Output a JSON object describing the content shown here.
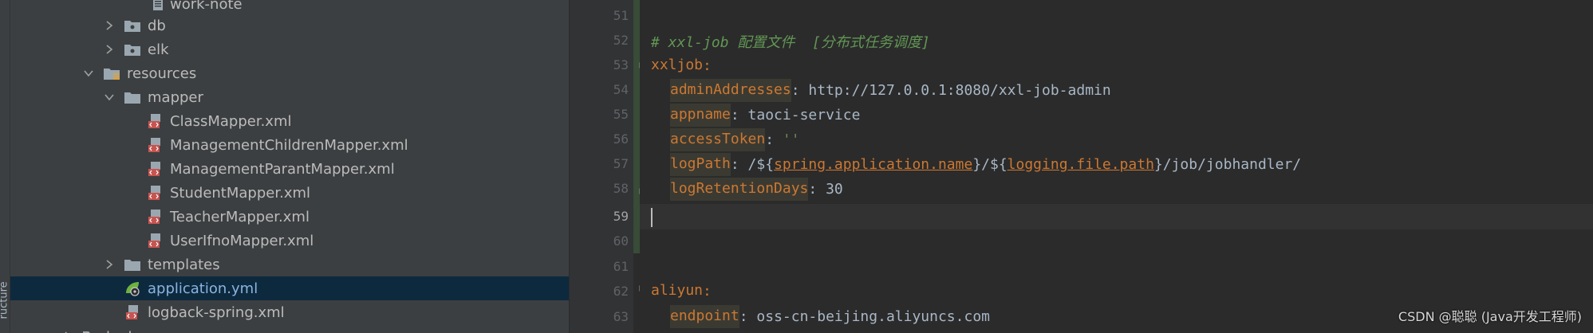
{
  "sidebar_strip": {
    "label": "ructure"
  },
  "project_tree": {
    "rows": [
      {
        "label": "work-note",
        "icon": "text-file-icon",
        "expander": "none"
      },
      {
        "label": "db",
        "icon": "folder-icon",
        "expander": "collapsed"
      },
      {
        "label": "elk",
        "icon": "folder-icon",
        "expander": "collapsed"
      },
      {
        "label": "resources",
        "icon": "resources-folder-icon",
        "expander": "expanded"
      },
      {
        "label": "mapper",
        "icon": "folder-icon",
        "expander": "expanded"
      },
      {
        "label": "ClassMapper.xml",
        "icon": "xml-mapper-file-icon",
        "expander": "none"
      },
      {
        "label": "ManagementChildrenMapper.xml",
        "icon": "xml-mapper-file-icon",
        "expander": "none"
      },
      {
        "label": "ManagementParantMapper.xml",
        "icon": "xml-mapper-file-icon",
        "expander": "none"
      },
      {
        "label": "StudentMapper.xml",
        "icon": "xml-mapper-file-icon",
        "expander": "none"
      },
      {
        "label": "TeacherMapper.xml",
        "icon": "xml-mapper-file-icon",
        "expander": "none"
      },
      {
        "label": "UserIfnoMapper.xml",
        "icon": "xml-mapper-file-icon",
        "expander": "none"
      },
      {
        "label": "templates",
        "icon": "folder-icon",
        "expander": "collapsed"
      },
      {
        "label": "application.yml",
        "icon": "spring-yaml-file-icon",
        "expander": "none",
        "selected": true
      },
      {
        "label": "logback-spring.xml",
        "icon": "xml-mapper-file-icon",
        "expander": "none"
      },
      {
        "label": "test",
        "icon": "folder-icon",
        "expander": "collapsed"
      }
    ]
  },
  "editor": {
    "current_line": "59",
    "lines": [
      {
        "num": "51",
        "key": "",
        "sep": "",
        "value": "",
        "comment": ""
      },
      {
        "num": "52",
        "comment": "# xxl-job 配置文件  [分布式任务调度]"
      },
      {
        "num": "53",
        "key": "xxljob",
        "sep": ":"
      },
      {
        "num": "54",
        "key": "adminAddresses",
        "sep": ": ",
        "value": "http://127.0.0.1:8080/xxl-job-admin"
      },
      {
        "num": "55",
        "key": "appname",
        "sep": ": ",
        "value": "taoci-service"
      },
      {
        "num": "56",
        "key": "accessToken",
        "sep": ": ",
        "value": "''"
      },
      {
        "num": "57",
        "key": "logPath",
        "sep": ": ",
        "v1": "/${",
        "ref1": "spring.application.name",
        "v2": "}/${",
        "ref2": "logging.file.path",
        "v3": "}/job/jobhandler/"
      },
      {
        "num": "58",
        "key": "logRetentionDays",
        "sep": ": ",
        "value": "30"
      },
      {
        "num": "59"
      },
      {
        "num": "60"
      },
      {
        "num": "61"
      },
      {
        "num": "62",
        "key": "aliyun",
        "sep": ":"
      },
      {
        "num": "63",
        "key": "endpoint",
        "sep": ": ",
        "value": "oss-cn-beijing.aliyuncs.com"
      }
    ]
  },
  "watermark": {
    "text": "CSDN @聪聪 (Java开发工程师)"
  },
  "colors": {
    "yaml_key": "#cc7832",
    "comment": "#629755",
    "selection": "#0d293e",
    "background": "#2b2b2b"
  }
}
